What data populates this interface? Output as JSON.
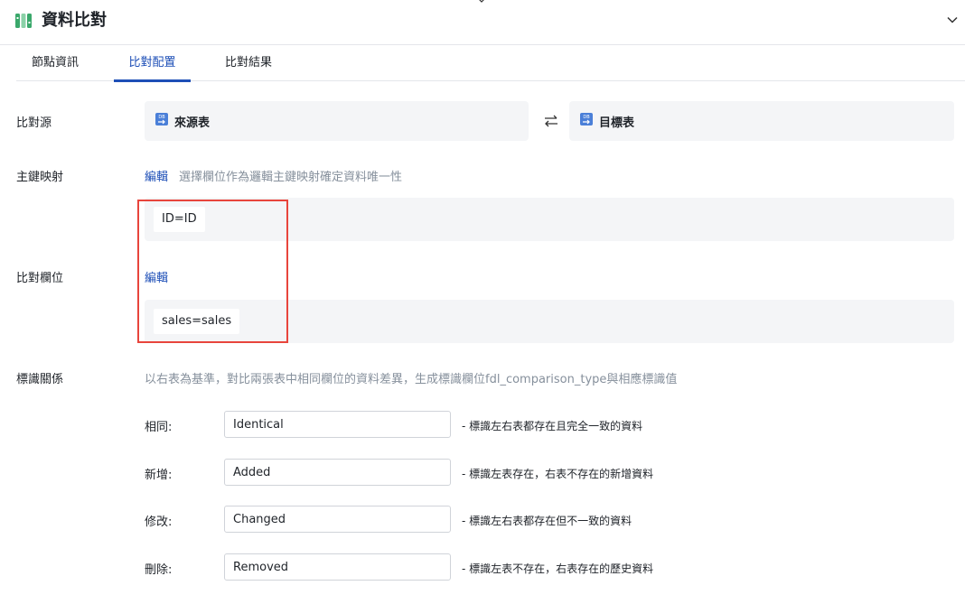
{
  "header": {
    "title": "資料比對",
    "collapse_icon": "chevron-down-icon",
    "logo_icon": "compare-logo-icon"
  },
  "tabs": [
    {
      "label": "節點資訊",
      "active": false
    },
    {
      "label": "比對配置",
      "active": true
    },
    {
      "label": "比對結果",
      "active": false
    }
  ],
  "source": {
    "label": "比對源",
    "left_table": "來源表",
    "right_table": "目標表",
    "swap_icon": "swap-arrows-icon",
    "table_icon": "db-table-icon"
  },
  "primary_key": {
    "label": "主鍵映射",
    "edit": "編輯",
    "hint": "選擇欄位作為邏輯主鍵映射確定資料唯一性",
    "mapping": "ID=ID"
  },
  "compare_fields": {
    "label": "比對欄位",
    "edit": "編輯",
    "mapping": "sales=sales"
  },
  "relation": {
    "label": "標識關係",
    "hint": "以右表為基準，對比兩張表中相同欄位的資料差異，生成標識欄位fdl_comparison_type與相應標識值",
    "rows": [
      {
        "label": "相同:",
        "value": "Identical",
        "desc": "- 標識左右表都存在且完全一致的資料"
      },
      {
        "label": "新增:",
        "value": "Added",
        "desc": "- 標識左表存在，右表不存在的新增資料"
      },
      {
        "label": "修改:",
        "value": "Changed",
        "desc": "- 標識左右表都存在但不一致的資料"
      },
      {
        "label": "刪除:",
        "value": "Removed",
        "desc": "- 標識左表不存在，右表存在的歷史資料"
      }
    ]
  },
  "colors": {
    "accent": "#1e4fb7",
    "highlight": "#e8453c",
    "panel": "#f4f5f7",
    "logo_green": "#3aa86b"
  }
}
